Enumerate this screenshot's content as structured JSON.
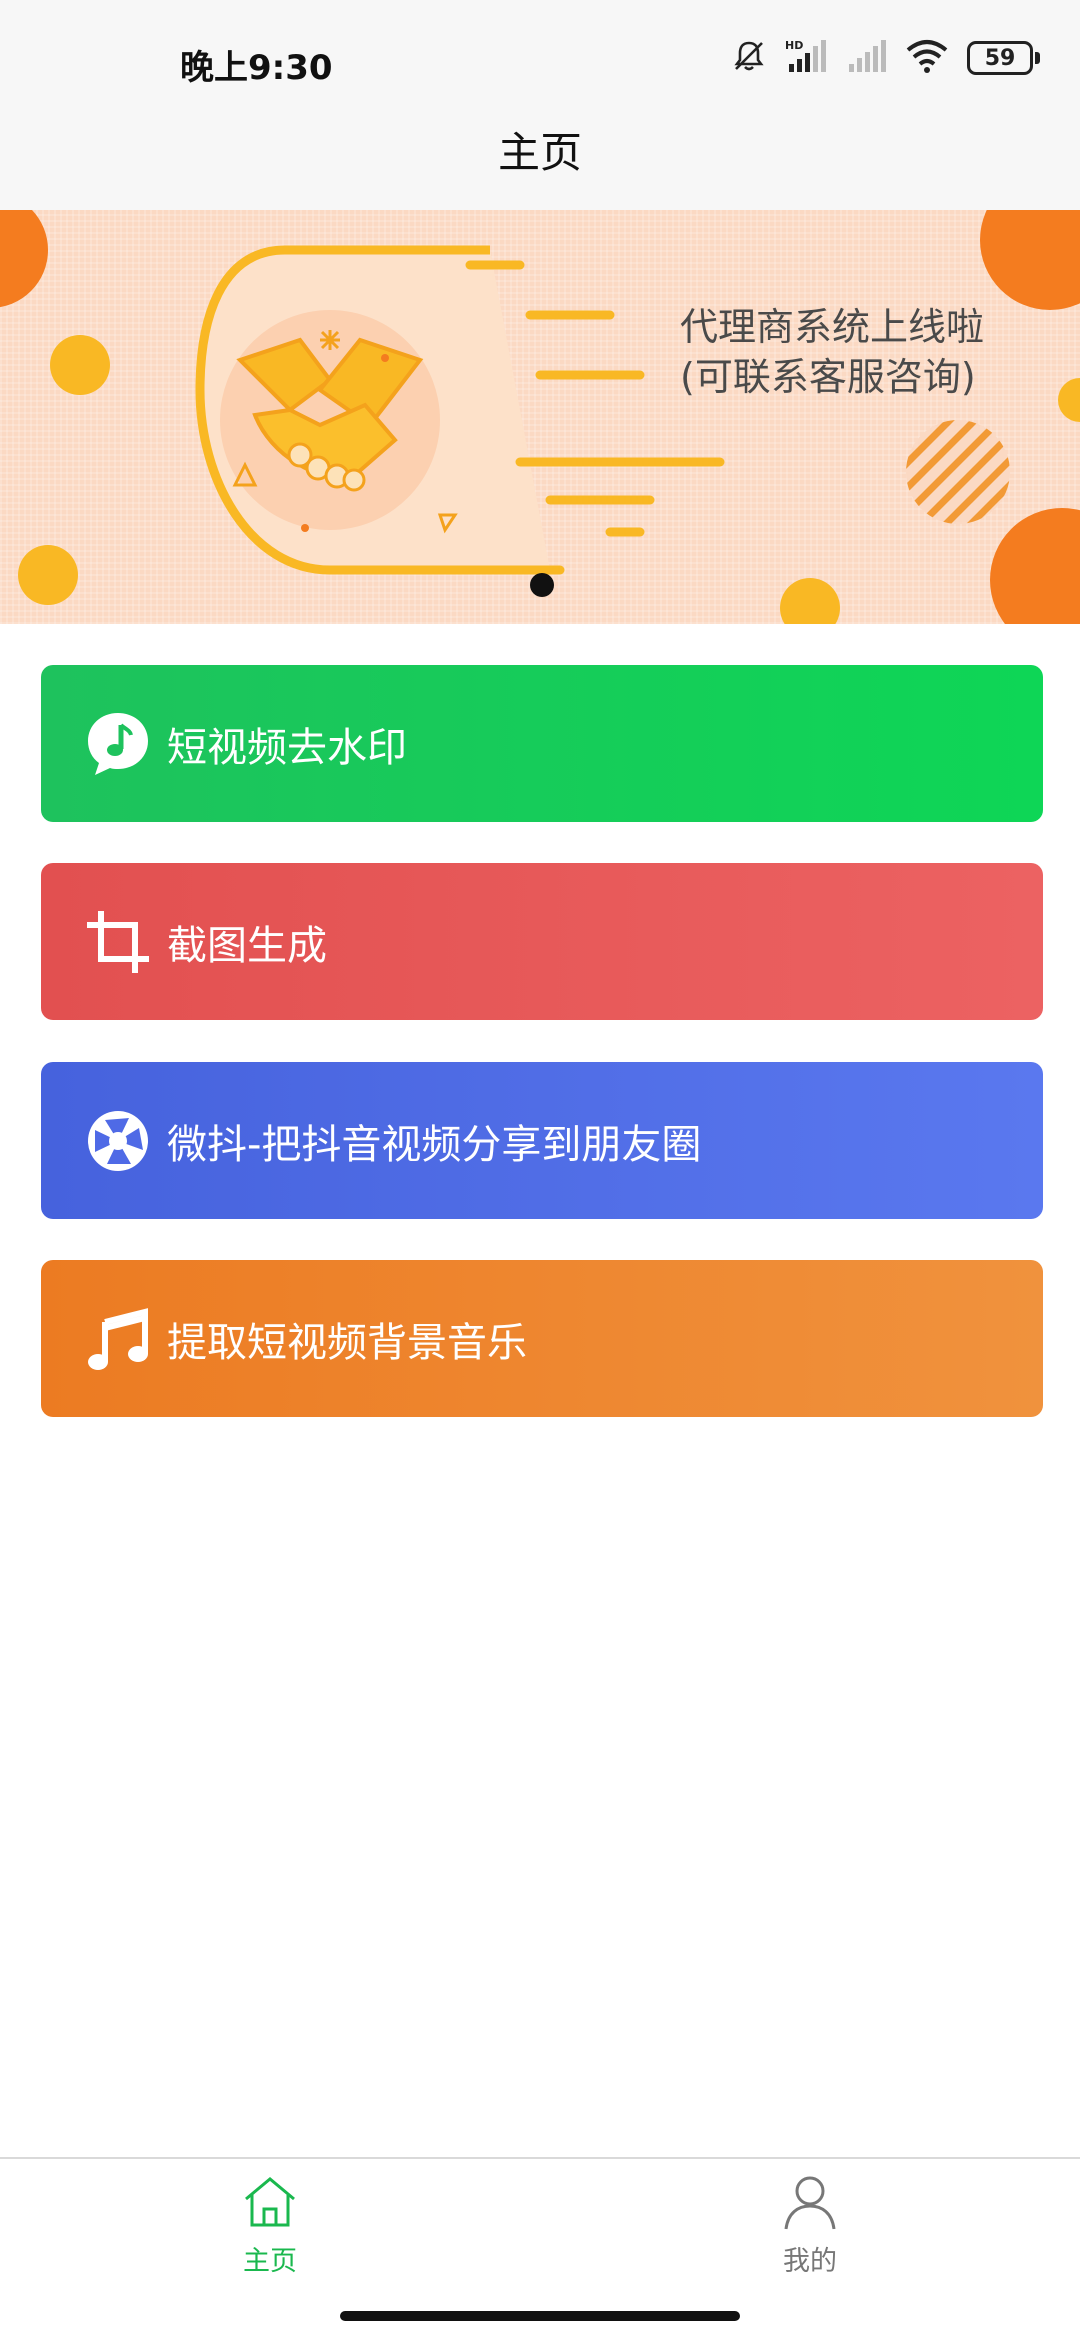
{
  "status_bar": {
    "time": "晚上9:30",
    "battery": "59",
    "icons": [
      "mute-icon",
      "hd-signal-icon",
      "signal-icon",
      "wifi-icon",
      "battery-icon"
    ]
  },
  "nav": {
    "title": "主页"
  },
  "banner": {
    "line1": "代理商系统上线啦",
    "line2": "(可联系客服咨询)",
    "colors": {
      "background": "#fbd9c3",
      "accent": "#f7b52b",
      "orange": "#f47c1f"
    }
  },
  "actions": [
    {
      "label": "短视频去水印",
      "icon": "music-bubble-icon",
      "color": "#1ec25d"
    },
    {
      "label": "截图生成",
      "icon": "crop-icon",
      "color": "#e45555"
    },
    {
      "label": "微抖-把抖音视频分享到朋友圈",
      "icon": "shutter-icon",
      "color": "#4f6ae6"
    },
    {
      "label": "提取短视频背景音乐",
      "icon": "music-notes-icon",
      "color": "#ee852e"
    }
  ],
  "tabs": [
    {
      "label": "主页",
      "icon": "home-icon",
      "active": true,
      "color": "#1ab84e"
    },
    {
      "label": "我的",
      "icon": "person-icon",
      "active": false,
      "color": "#777777"
    }
  ]
}
